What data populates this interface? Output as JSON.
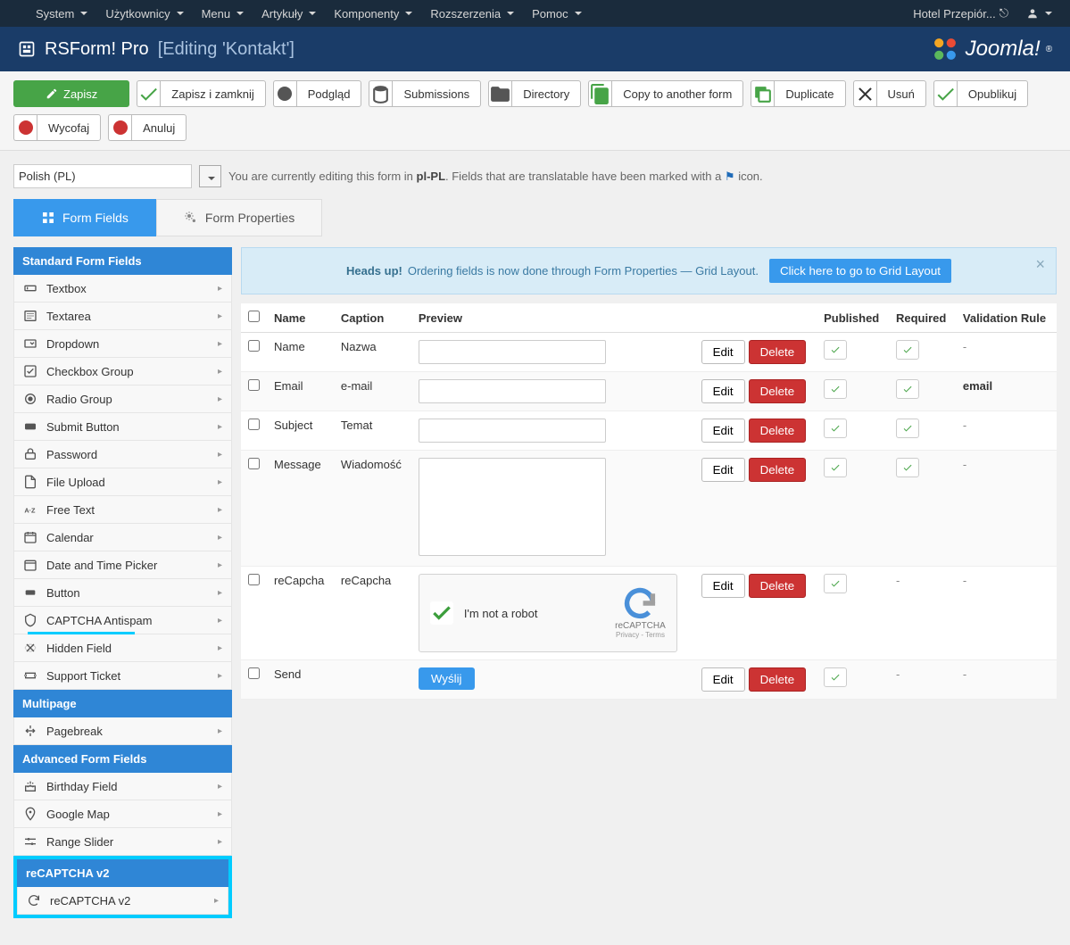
{
  "topbar": {
    "left": [
      "System",
      "Użytkownicy",
      "Menu",
      "Artykuły",
      "Komponenty",
      "Rozszerzenia",
      "Pomoc"
    ],
    "site_name": "Hotel Przepiór..."
  },
  "header": {
    "title": "RSForm! Pro",
    "subtitle": "[Editing 'Kontakt']",
    "brand": "Joomla!"
  },
  "toolbar": {
    "save": "Zapisz",
    "save_close": "Zapisz i zamknij",
    "preview": "Podgląd",
    "submissions": "Submissions",
    "directory": "Directory",
    "copy": "Copy to another form",
    "duplicate": "Duplicate",
    "delete": "Usuń",
    "publish": "Opublikuj",
    "unpublish": "Wycofaj",
    "cancel": "Anuluj"
  },
  "lang": {
    "selected": "Polish (PL)",
    "text_a": "You are currently editing this form in ",
    "locale": "pl-PL",
    "text_b": ". Fields that are translatable have been marked with a ",
    "text_c": " icon."
  },
  "tabs": {
    "fields": "Form Fields",
    "props": "Form Properties"
  },
  "sidebar": {
    "standard": "Standard Form Fields",
    "items_standard": [
      "Textbox",
      "Textarea",
      "Dropdown",
      "Checkbox Group",
      "Radio Group",
      "Submit Button",
      "Password",
      "File Upload",
      "Free Text",
      "Calendar",
      "Date and Time Picker",
      "Button",
      "CAPTCHA Antispam",
      "Hidden Field",
      "Support Ticket"
    ],
    "multipage": "Multipage",
    "items_multipage": [
      "Pagebreak"
    ],
    "advanced": "Advanced Form Fields",
    "items_advanced": [
      "Birthday Field",
      "Google Map",
      "Range Slider"
    ],
    "recaptcha_h": "reCAPTCHA v2",
    "items_recaptcha": [
      "reCAPTCHA v2"
    ]
  },
  "alert": {
    "heads_up": "Heads up!",
    "text": "Ordering fields is now done through Form Properties — Grid Layout.",
    "btn": "Click here to go to Grid Layout"
  },
  "table": {
    "headers": {
      "name": "Name",
      "caption": "Caption",
      "preview": "Preview",
      "published": "Published",
      "required": "Required",
      "validation": "Validation Rule"
    },
    "edit": "Edit",
    "delete": "Delete",
    "rows": [
      {
        "name": "Name",
        "caption": "Nazwa",
        "type": "text",
        "published": true,
        "required": true,
        "validation": "-"
      },
      {
        "name": "Email",
        "caption": "e-mail",
        "type": "text",
        "published": true,
        "required": true,
        "validation": "email"
      },
      {
        "name": "Subject",
        "caption": "Temat",
        "type": "text",
        "published": true,
        "required": true,
        "validation": "-"
      },
      {
        "name": "Message",
        "caption": "Wiadomość",
        "type": "textarea",
        "published": true,
        "required": true,
        "validation": "-"
      },
      {
        "name": "reCapcha",
        "caption": "reCapcha",
        "type": "recaptcha",
        "published": true,
        "required": "-",
        "validation": "-"
      },
      {
        "name": "Send",
        "caption": "",
        "type": "submit",
        "submit_label": "Wyślij",
        "published": true,
        "required": "-",
        "validation": "-"
      }
    ],
    "recaptcha": {
      "label": "I'm not a robot",
      "brand": "reCAPTCHA",
      "privacy": "Privacy - Terms"
    }
  }
}
